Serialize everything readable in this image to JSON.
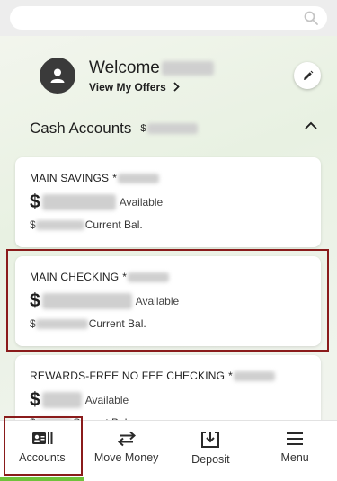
{
  "search": {
    "icon": "search-icon"
  },
  "welcome": {
    "greeting": "Welcome",
    "offers_link": "View My Offers",
    "avatar_icon": "person-icon",
    "edit_icon": "pencil-icon"
  },
  "cash_accounts": {
    "title": "Cash Accounts",
    "total_prefix": "$",
    "collapse_icon": "chevron-up-icon"
  },
  "accounts": [
    {
      "name": "MAIN SAVINGS",
      "mask_prefix": "*",
      "dollar": "$",
      "available_label": "Available",
      "current_prefix": "$",
      "current_label": "Current Bal."
    },
    {
      "name": "MAIN CHECKING",
      "mask_prefix": "*",
      "dollar": "$",
      "available_label": "Available",
      "current_prefix": "$",
      "current_label": "Current Bal."
    },
    {
      "name": "REWARDS-FREE NO FEE CHECKING",
      "mask_prefix": "*",
      "dollar": "$",
      "available_label": "Available",
      "current_prefix": "$",
      "current_label": "Current Bal."
    }
  ],
  "bottom_nav": [
    {
      "label": "Accounts",
      "icon": "accounts-icon",
      "active": true
    },
    {
      "label": "Move Money",
      "icon": "transfer-arrows-icon"
    },
    {
      "label": "Deposit",
      "icon": "deposit-icon"
    },
    {
      "label": "Menu",
      "icon": "hamburger-menu-icon"
    }
  ],
  "colors": {
    "highlight_border": "#8a1b1b",
    "active_indicator": "#6fc23b",
    "avatar_bg": "#3a3a3a"
  }
}
